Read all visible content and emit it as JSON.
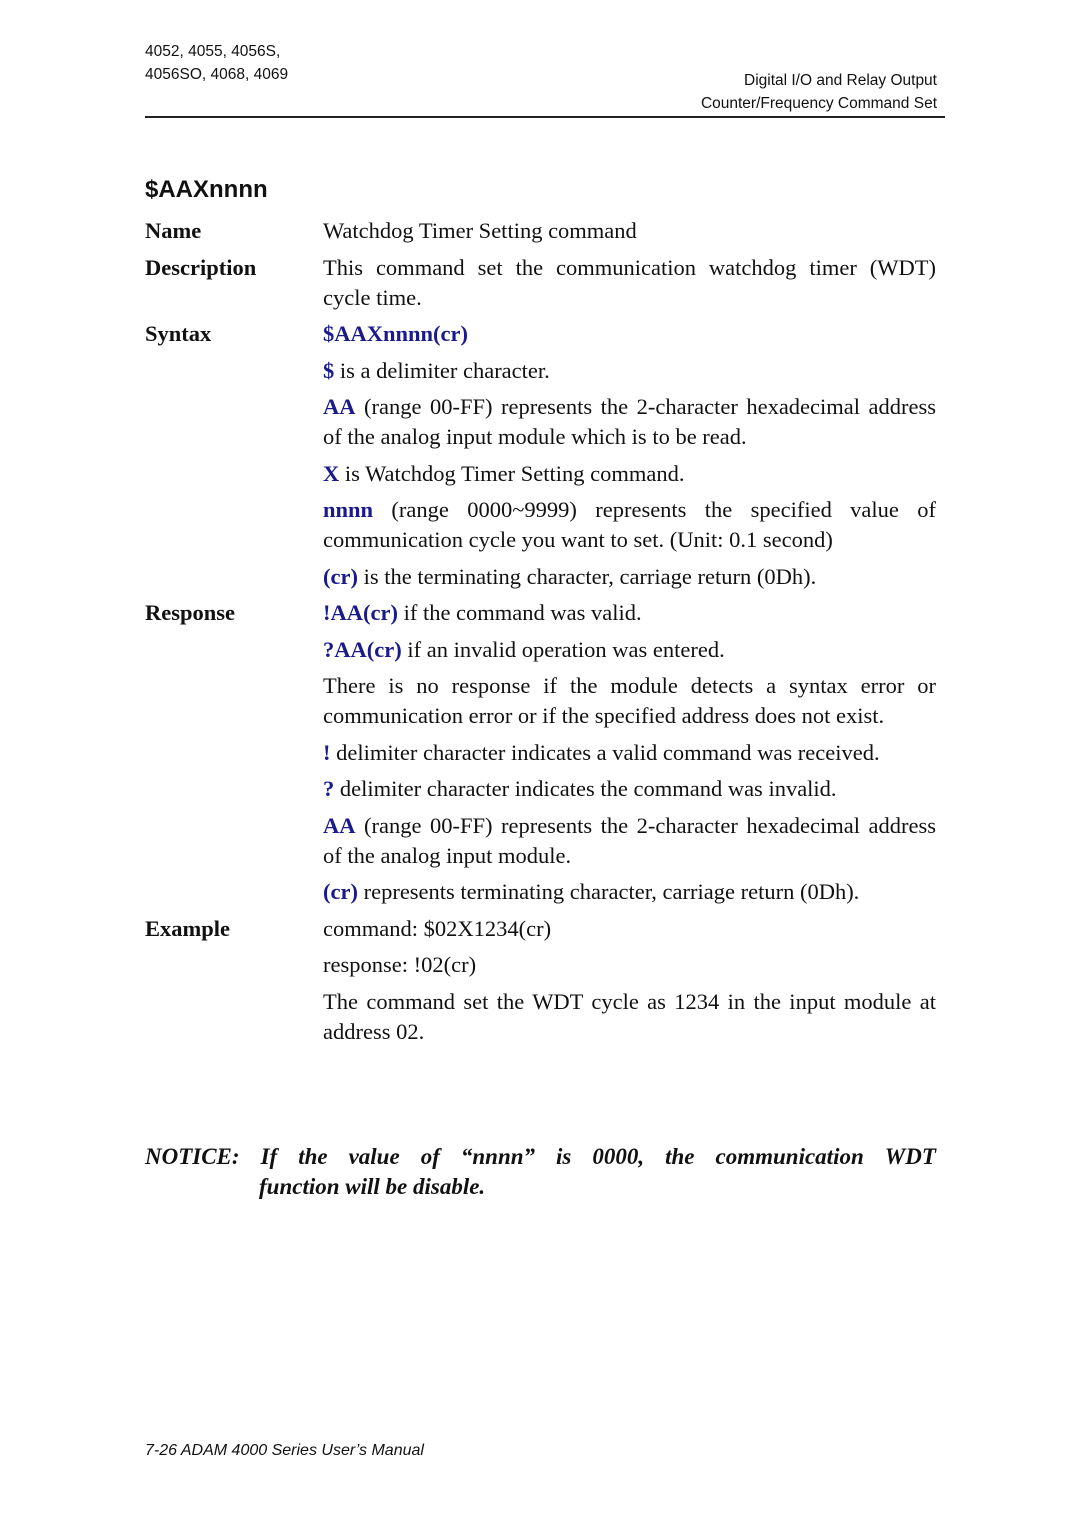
{
  "header": {
    "left_line1": "4052, 4055, 4056S,",
    "left_line2": "4056SO, 4068, 4069",
    "right_line1": "Digital I/O and Relay Output",
    "right_line2": "Counter/Frequency Command Set"
  },
  "title": "$AAXnnnn",
  "sections": {
    "name": {
      "label": "Name",
      "text": "Watchdog Timer Setting command"
    },
    "description": {
      "label": "Description",
      "text": "This command set the communication watchdog timer (WDT) cycle time."
    },
    "syntax": {
      "label": "Syntax",
      "command": "$AAXnnnn(cr)",
      "items": [
        {
          "key": "$",
          "text": " is a delimiter character."
        },
        {
          "key": "AA",
          "text": " (range 00-FF) represents the 2-character hexadecimal address of the analog input module which is to be read."
        },
        {
          "key": "X",
          "text": " is Watchdog Timer Setting command."
        },
        {
          "key": "nnnn",
          "text": " (range 0000~9999) represents the specified value of communication cycle you want to set. (Unit: 0.1 second)"
        },
        {
          "key": "(cr)",
          "text": " is the terminating character, carriage return (0Dh)."
        }
      ]
    },
    "response": {
      "label": "Response",
      "items": [
        {
          "key": "!AA(cr)",
          "text": " if the command was valid."
        },
        {
          "key": "?AA(cr)",
          "text": " if an invalid operation was entered."
        },
        {
          "key": "",
          "text": "There is no response if the module detects a syntax error or communication error or if the specified address does not exist."
        },
        {
          "key": "!",
          "text": " delimiter character indicates a valid command was received."
        },
        {
          "key": "?",
          "text": " delimiter character indicates the command was invalid."
        },
        {
          "key": "AA",
          "text": " (range 00-FF) represents the 2-character hexadecimal address of the analog input module."
        },
        {
          "key": "(cr)",
          "text": " represents terminating character, carriage return (0Dh)."
        }
      ]
    },
    "example": {
      "label": "Example",
      "command": "command: $02X1234(cr)",
      "response": "response: !02(cr)",
      "explanation": "The command set the WDT cycle as 1234 in the input module at address 02."
    }
  },
  "notice": {
    "words_line1": [
      "NOTICE:",
      "If",
      "the",
      "value",
      "of",
      "“nnnn”",
      "is",
      "0000,",
      "the",
      "communication",
      "WDT"
    ],
    "line2": "function will be disable."
  },
  "footer": "7-26 ADAM 4000 Series User’s Manual",
  "colors": {
    "accent_blue": "#1a1a8c"
  }
}
